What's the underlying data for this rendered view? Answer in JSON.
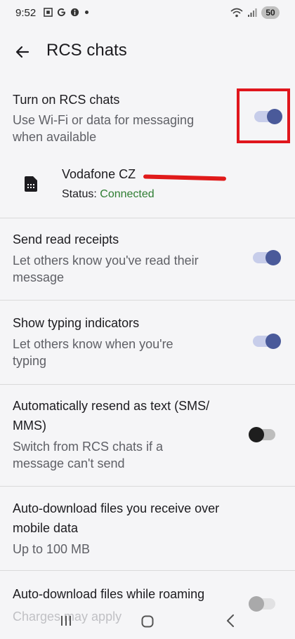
{
  "status_bar": {
    "time": "9:52",
    "battery": "50",
    "icons": [
      "screenshot-icon",
      "google-icon",
      "info-icon",
      "wifi-icon",
      "signal-icon"
    ]
  },
  "header": {
    "title": "RCS chats"
  },
  "settings": [
    {
      "title": "Turn on RCS chats",
      "subtitle": "Use Wi-Fi or data for messaging when available",
      "subtitle_lines": [
        "Use Wi-Fi or data for messaging",
        "when available"
      ],
      "enabled": true
    },
    {
      "title": "Send read receipts",
      "subtitle_lines": [
        "Let others know you've read their",
        "message"
      ],
      "enabled": true
    },
    {
      "title": "Show typing indicators",
      "subtitle_lines": [
        "Let others know when you're",
        "typing"
      ],
      "enabled": true
    },
    {
      "title_lines": [
        "Automatically resend as text (SMS/",
        "MMS)"
      ],
      "subtitle_lines": [
        "Switch from RCS chats if a",
        "message can't send"
      ],
      "enabled": false
    },
    {
      "title_lines": [
        "Auto-download files you receive over",
        "mobile data"
      ],
      "subtitle": "Up to 100 MB"
    },
    {
      "title": "Auto-download files while roaming",
      "subtitle": "Charges may apply",
      "enabled": false
    }
  ],
  "sim": {
    "carrier": "Vodafone CZ",
    "status_label": "Status:",
    "status_value": "Connected"
  },
  "colors": {
    "accent": "#4a5a9a",
    "connected": "#2e7d32",
    "highlight": "#e0161d"
  }
}
